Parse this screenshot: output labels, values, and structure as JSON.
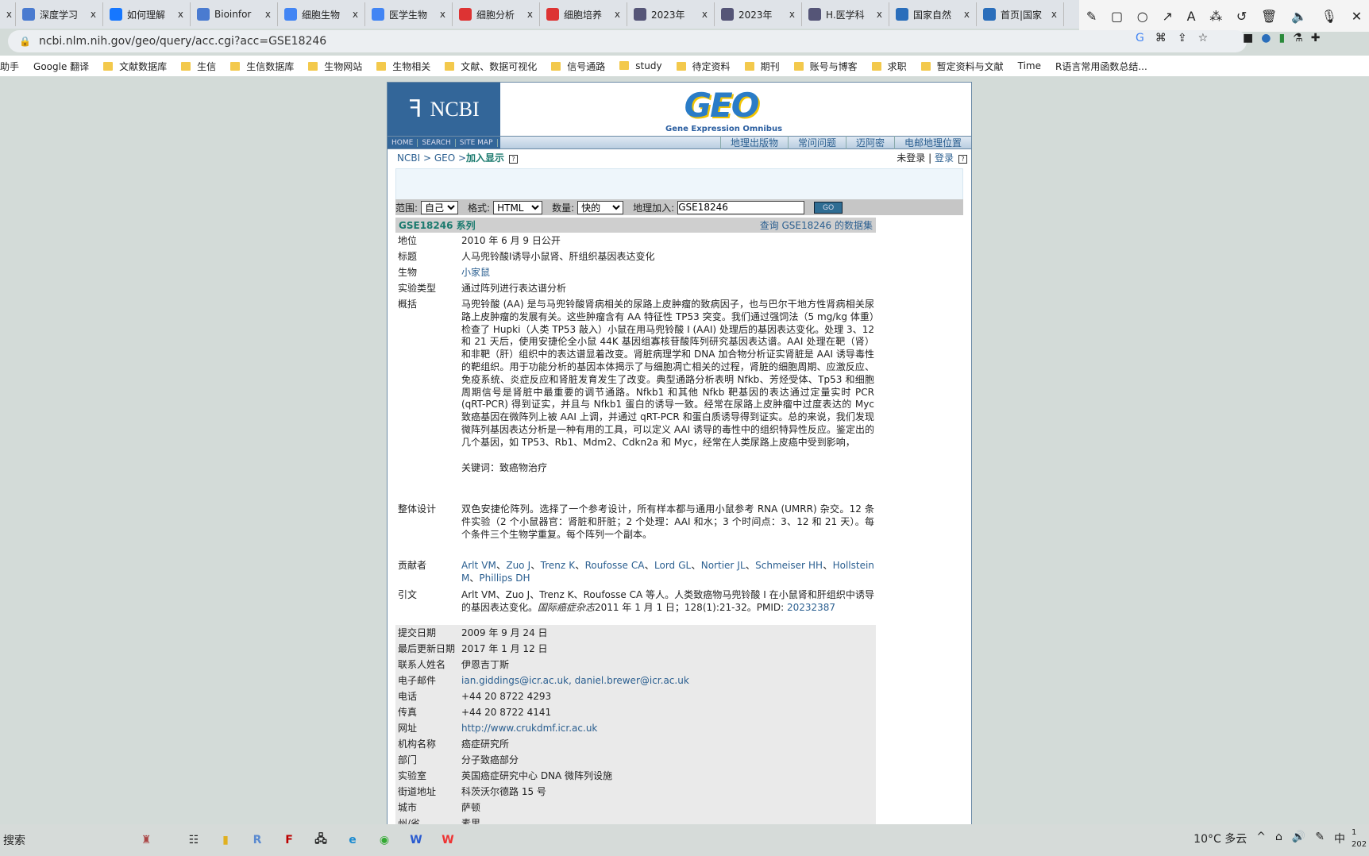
{
  "browser": {
    "tabs": [
      {
        "label": "深度学习",
        "icon": "bio-logo",
        "color": "#4a7bd0"
      },
      {
        "label": "如何理解",
        "icon": "zhihu-icon",
        "color": "#1677ff"
      },
      {
        "label": "Bioinfor",
        "icon": "bio-logo",
        "color": "#4a7bd0"
      },
      {
        "label": "细胞生物",
        "icon": "google-icon",
        "color": "#4285f4"
      },
      {
        "label": "医学生物",
        "icon": "google-icon",
        "color": "#4285f4"
      },
      {
        "label": "细胞分析",
        "icon": "t-icon",
        "color": "#d33"
      },
      {
        "label": "细胞培养",
        "icon": "t-icon",
        "color": "#d33"
      },
      {
        "label": "2023年",
        "icon": "circle-icon",
        "color": "#557"
      },
      {
        "label": "2023年",
        "icon": "circle-icon",
        "color": "#557"
      },
      {
        "label": "H.医学科",
        "icon": "circle-icon",
        "color": "#557"
      },
      {
        "label": "国家自然",
        "icon": "globe-icon",
        "color": "#2a6ebb"
      },
      {
        "label": "首页|国家",
        "icon": "globe-icon",
        "color": "#2a6ebb"
      }
    ],
    "close_glyph": "x",
    "url": "ncbi.nlm.nih.gov/geo/query/acc.cgi?acc=GSE18246",
    "bookmarks": [
      {
        "label": "助手",
        "folder": false
      },
      {
        "label": "Google 翻译",
        "folder": false
      },
      {
        "label": "文献数据库",
        "folder": true
      },
      {
        "label": "生信",
        "folder": true
      },
      {
        "label": "生信数据库",
        "folder": true
      },
      {
        "label": "生物网站",
        "folder": true
      },
      {
        "label": "生物相关",
        "folder": true
      },
      {
        "label": "文献、数据可视化",
        "folder": true
      },
      {
        "label": "信号通路",
        "folder": true
      },
      {
        "label": "study",
        "folder": true
      },
      {
        "label": "待定资料",
        "folder": true
      },
      {
        "label": "期刊",
        "folder": true
      },
      {
        "label": "账号与博客",
        "folder": true
      },
      {
        "label": "求职",
        "folder": true
      },
      {
        "label": "暂定资料与文献",
        "folder": true
      },
      {
        "label": "Time",
        "folder": false
      },
      {
        "label": "R语言常用函数总结...",
        "folder": false
      }
    ]
  },
  "geo": {
    "ncbi_label": "NCBI",
    "geo_logo": "GEO",
    "geo_subtitle": "Gene Expression Omnibus",
    "nav_left": [
      "HOME",
      "SEARCH",
      "SITE MAP"
    ],
    "nav_right": [
      "地理出版物",
      "常问问题",
      "迈阿密",
      "电邮地理位置"
    ],
    "breadcrumb": {
      "ncbi": "NCBI",
      "sep": " > ",
      "geo": "GEO",
      "current": "加入显示"
    },
    "help_glyph": "?",
    "login": {
      "status": "未登录",
      "sep": "|",
      "link": "登录"
    },
    "form": {
      "scope_label": "范围:",
      "scope_value": "自己",
      "format_label": "格式:",
      "format_value": "HTML",
      "amount_label": "数量:",
      "amount_value": "快的",
      "acc_label": "地理加入:",
      "acc_value": "GSE18246",
      "go": "GO"
    },
    "series_title": "GSE18246 系列",
    "dataset_link": "查询 GSE18246 的数据集",
    "fields": {
      "status": {
        "k": "地位",
        "v": "2010 年 6 月 9 日公开"
      },
      "title": {
        "k": "标题",
        "v": "人马兜铃酸I诱导小鼠肾、肝组织基因表达变化"
      },
      "organism": {
        "k": "生物",
        "v": "小家鼠"
      },
      "type": {
        "k": "实验类型",
        "v": "通过阵列进行表达谱分析"
      },
      "summary": {
        "k": "概括",
        "v": "马兜铃酸 (AA) 是与马兜铃酸肾病相关的尿路上皮肿瘤的致病因子，也与巴尔干地方性肾病相关尿路上皮肿瘤的发展有关。这些肿瘤含有 AA 特征性 TP53 突变。我们通过强饲法（5 mg/kg 体重）检查了 Hupki（人类 TP53 敲入）小鼠在用马兜铃酸 I (AAI) 处理后的基因表达变化。处理 3、12 和 21 天后，使用安捷伦全小鼠 44K 基因组寡核苷酸阵列研究基因表达谱。AAI 处理在靶（肾）和非靶（肝）组织中的表达谱显着改变。肾脏病理学和 DNA 加合物分析证实肾脏是 AAI 诱导毒性的靶组织。用于功能分析的基因本体揭示了与细胞凋亡相关的过程，肾脏的细胞周期、应激反应、免疫系统、炎症反应和肾脏发育发生了改变。典型通路分析表明 Nfkb、芳烃受体、Tp53 和细胞周期信号是肾脏中最重要的调节通路。Nfkb1 和其他 Nfkb 靶基因的表达通过定量实时 PCR (qRT-PCR) 得到证实，并且与 Nfkb1 蛋白的诱导一致。经常在尿路上皮肿瘤中过度表达的 Myc 致癌基因在微阵列上被 AAI 上调，并通过 qRT-PCR 和蛋白质诱导得到证实。总的来说，我们发现微阵列基因表达分析是一种有用的工具，可以定义 AAI 诱导的毒性中的组织特异性反应。鉴定出的几个基因，如 TP53、Rb1、Mdm2、Cdkn2a 和 Myc，经常在人类尿路上皮癌中受到影响，",
        "keywords": "关键词：致癌物治疗"
      },
      "design": {
        "k": "整体设计",
        "v": "双色安捷伦阵列。选择了一个参考设计，所有样本都与通用小鼠参考 RNA (UMRR) 杂交。12 条件实验（2 个小鼠器官：肾脏和肝脏；2 个处理：AAI 和水；3 个时间点：3、12 和 21 天）。每个条件三个生物学重复。每个阵列一个副本。"
      },
      "contributors": {
        "k": "贡献者",
        "v": [
          "Arlt VM",
          "Zuo J",
          "Trenz K",
          "Roufosse CA",
          "Lord GL",
          "Nortier JL",
          "Schmeiser HH",
          "Hollstein M",
          "Phillips DH"
        ]
      },
      "citation": {
        "k": "引文",
        "v1": "Arlt VM、Zuo J、Trenz K、Roufosse CA 等人。人类致癌物马兜铃酸 I 在小鼠肾和肝组织中诱导的基因表达变化。",
        "journal": "国际癌症杂志",
        "v2": "2011 年 1 月 1 日；128(1):21-32。PMID: ",
        "pmid": "20232387"
      }
    },
    "contact": [
      {
        "k": "提交日期",
        "v": "2009 年 9 月 24 日",
        "link": false
      },
      {
        "k": "最后更新日期",
        "v": "2017 年 1 月 12 日",
        "link": false
      },
      {
        "k": "联系人姓名",
        "v": "伊恩吉丁斯",
        "link": false
      },
      {
        "k": "电子邮件",
        "v": "ian.giddings@icr.ac.uk, daniel.brewer@icr.ac.uk",
        "link": true
      },
      {
        "k": "电话",
        "v": "+44 20 8722 4293",
        "link": false
      },
      {
        "k": "传真",
        "v": "+44 20 8722 4141",
        "link": false
      },
      {
        "k": "网址",
        "v": "http://www.crukdmf.icr.ac.uk",
        "link": true
      },
      {
        "k": "机构名称",
        "v": "癌症研究所",
        "link": false
      },
      {
        "k": "部门",
        "v": "分子致癌部分",
        "link": false
      },
      {
        "k": "实验室",
        "v": "英国癌症研究中心 DNA 微阵列设施",
        "link": false
      },
      {
        "k": "街道地址",
        "v": "科茨沃尔德路 15 号",
        "link": false
      },
      {
        "k": "城市",
        "v": "萨顿",
        "link": false
      },
      {
        "k": "州/省",
        "v": "素里",
        "link": false
      }
    ]
  },
  "taskbar": {
    "search": "搜索",
    "weather": "10°C 多云",
    "ime": "中",
    "clock": "1\n202"
  }
}
